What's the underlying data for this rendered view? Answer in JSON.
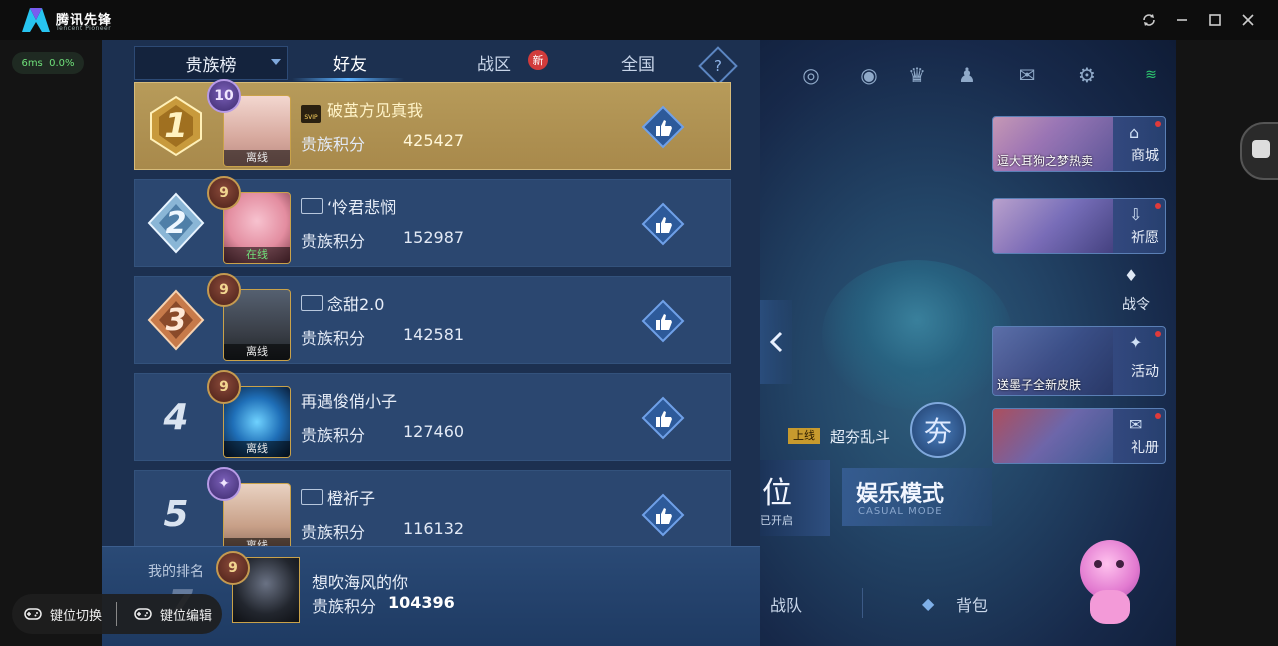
{
  "app": {
    "brand": "腾讯先锋",
    "brand_sub": "Tencent Pioneer"
  },
  "window_controls": [
    "refresh-icon",
    "minimize-icon",
    "maximize-icon",
    "close-icon"
  ],
  "netstat": {
    "latency": "6ms",
    "loss": "0.0%"
  },
  "panel": {
    "dropdown_label": "贵族榜",
    "tabs": [
      {
        "label": "好友",
        "selected": true
      },
      {
        "label": "战区",
        "badge": "新"
      },
      {
        "label": "全国"
      }
    ],
    "rows": [
      {
        "rank": "1",
        "level": "10",
        "name": "破茧方见真我",
        "vip": "SVIP",
        "status": "离线",
        "score_label": "贵族积分",
        "score": "425427"
      },
      {
        "rank": "2",
        "level": "9",
        "name": "‘怜君悲悯",
        "status": "在线",
        "score_label": "贵族积分",
        "score": "152987"
      },
      {
        "rank": "3",
        "level": "9",
        "name": "念甜2.0",
        "status": "离线",
        "score_label": "贵族积分",
        "score": "142581"
      },
      {
        "rank": "4",
        "level": "9",
        "name": "再遇俊俏小子",
        "status": "离线",
        "score_label": "贵族积分",
        "score": "127460"
      },
      {
        "rank": "5",
        "level": "",
        "name": "橙祈子",
        "status": "离线",
        "score_label": "贵族积分",
        "score": "116132"
      }
    ],
    "me": {
      "label": "我的排名",
      "rank_hint": "7",
      "level": "9",
      "name": "想吹海风的你",
      "score_label": "贵族积分",
      "score": "104396"
    }
  },
  "game_right": {
    "cards": [
      {
        "caption": "逗大耳狗之梦热卖",
        "label": "商城"
      },
      {
        "caption": "",
        "label": "祈愿"
      },
      {
        "caption": "送墨子全新皮肤",
        "label": "活动"
      },
      {
        "caption": "",
        "label": "礼册"
      }
    ],
    "battle_pass": "战令",
    "promo_tag": "上线",
    "promo_text": "超夯乱斗",
    "rank_mode_char": "位",
    "rank_mode_sub": "已开启",
    "casual_mode": "娱乐模式",
    "casual_mode_en": "CASUAL MODE",
    "bottom_tabs": [
      "战队",
      "背包"
    ]
  },
  "float_toolbar": {
    "switch_label": "键位切换",
    "edit_label": "键位编辑"
  }
}
